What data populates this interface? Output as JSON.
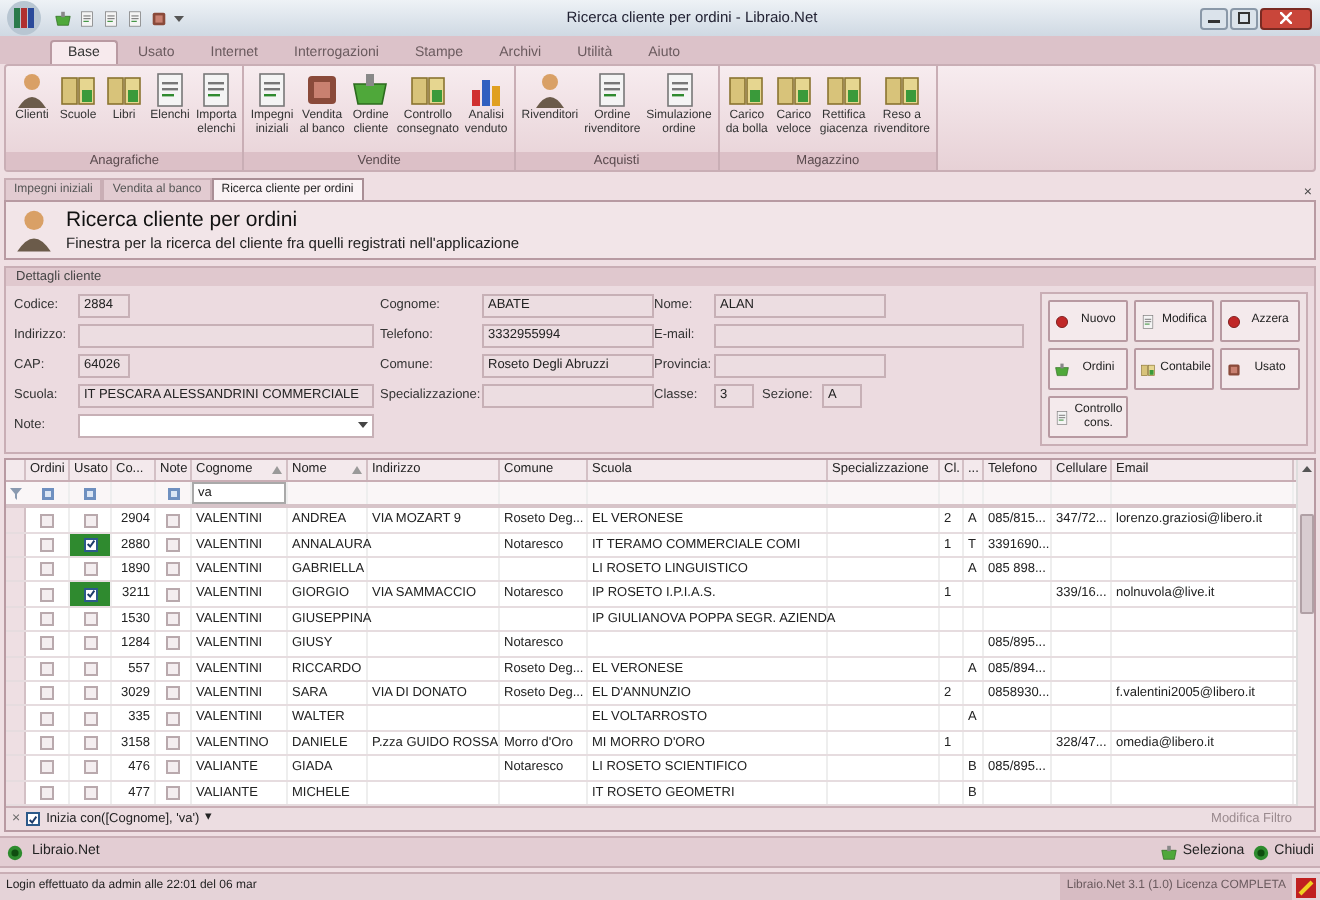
{
  "window": {
    "title": "Ricerca cliente per ordini - Libraio.Net"
  },
  "ribbon": {
    "tabs": [
      {
        "label": "Base",
        "selected": true
      },
      {
        "label": "Usato",
        "selected": false
      },
      {
        "label": "Internet",
        "selected": false
      },
      {
        "label": "Interrogazioni",
        "selected": false
      },
      {
        "label": "Stampe",
        "selected": false
      },
      {
        "label": "Archivi",
        "selected": false
      },
      {
        "label": "Utilità",
        "selected": false
      },
      {
        "label": "Aiuto",
        "selected": false
      }
    ],
    "groups": [
      {
        "title": "Anagrafiche",
        "buttons": [
          "Clienti",
          "Scuole",
          "Libri",
          "Elenchi",
          "Importa\nelenchi"
        ]
      },
      {
        "title": "Vendite",
        "buttons": [
          "Impegni\niniziali",
          "Vendita\nal banco",
          "Ordine\ncliente",
          "Controllo\nconsegnato",
          "Analisi\nvenduto"
        ]
      },
      {
        "title": "Acquisti",
        "buttons": [
          "Rivenditori",
          "Ordine\nrivenditore",
          "Simulazione\nordine"
        ]
      },
      {
        "title": "Magazzino",
        "buttons": [
          "Carico\nda bolla",
          "Carico\nveloce",
          "Rettifica\ngiacenza",
          "Reso a\nrivenditore"
        ]
      }
    ]
  },
  "doc_tabs": [
    {
      "label": "Impegni iniziali",
      "selected": false
    },
    {
      "label": "Vendita al banco",
      "selected": false
    },
    {
      "label": "Ricerca cliente per ordini",
      "selected": true
    }
  ],
  "doc_close": "×",
  "header": {
    "title": "Ricerca cliente per ordini",
    "subtitle": "Finestra per la ricerca del cliente fra quelli registrati nell'applicazione"
  },
  "details": {
    "title": "Dettagli cliente",
    "rows": [
      [
        [
          {
            "label": "Codice:",
            "value": "2884",
            "kind": "short"
          }
        ],
        [
          {
            "label": "Cognome:",
            "value": "ABATE",
            "kind": "medium"
          }
        ],
        [
          {
            "label": "Nome:",
            "value": "ALAN",
            "kind": "medium"
          }
        ]
      ],
      [
        [
          {
            "label": "Indirizzo:",
            "kind": "long"
          }
        ],
        [
          {
            "label": "Telefono:",
            "value": "3332955994",
            "kind": "medium"
          }
        ],
        [
          {
            "label": "E-mail:",
            "kind": "wide"
          }
        ]
      ],
      [
        [
          {
            "label": "CAP:",
            "value": "64026",
            "kind": "short"
          }
        ],
        [
          {
            "label": "Comune:",
            "value": "Roseto Degli Abruzzi",
            "kind": "medium"
          }
        ],
        [
          {
            "label": "Provincia:",
            "kind": "medium"
          }
        ]
      ],
      [
        [
          {
            "label": "Scuola:",
            "value": "IT PESCARA ALESSANDRINI COMMERCIALE",
            "kind": "long"
          }
        ],
        [
          {
            "label": "Specializzazione:",
            "kind": "medium"
          }
        ],
        [
          {
            "label": "Classe:",
            "value": "3",
            "kind": "tiny"
          },
          {
            "label": "Sezione:",
            "value": "A",
            "kind": "tiny"
          }
        ]
      ],
      [
        [
          {
            "label": "Note:",
            "kind": "dropdown"
          }
        ]
      ]
    ],
    "buttons": [
      "Nuovo",
      "Modifica",
      "Azzera",
      "Ordini",
      "Contabile",
      "Usato",
      "Controllo\ncons."
    ]
  },
  "table": {
    "columns": [
      "Ordini",
      "Usato",
      "Co...",
      "Note",
      "Cognome",
      "Nome",
      "Indirizzo",
      "Comune",
      "Scuola",
      "Specializzazione",
      "Cl.",
      "...",
      "Telefono",
      "Cellulare",
      "Email"
    ],
    "filter": {
      "cognome": "va"
    },
    "rows": [
      {
        "ordini": false,
        "usato": false,
        "note": false,
        "cells": [
          "",
          "",
          "2904",
          "",
          "VALENTINI",
          "ANDREA",
          "VIA MOZART 9",
          "Roseto Deg...",
          "EL VERONESE",
          null,
          "2",
          "A",
          "085/815...",
          "347/72...",
          "lorenzo.graziosi@libero.it"
        ]
      },
      {
        "ordini": false,
        "usato": true,
        "note": false,
        "cells": [
          "",
          "",
          "2880",
          "",
          "VALENTINI",
          "ANNALAURA",
          null,
          "Notaresco",
          "IT TERAMO COMMERCIALE COMI",
          null,
          "1",
          "T",
          "3391690...",
          null,
          null
        ]
      },
      {
        "ordini": false,
        "usato": false,
        "note": false,
        "cells": [
          "",
          "",
          "1890",
          "",
          "VALENTINI",
          "GABRIELLA",
          null,
          null,
          "LI ROSETO LINGUISTICO",
          null,
          null,
          "A",
          "085 898...",
          null,
          null
        ]
      },
      {
        "ordini": false,
        "usato": true,
        "note": false,
        "cells": [
          "",
          "",
          "3211",
          "",
          "VALENTINI",
          "GIORGIO",
          "VIA SAMMACCIO",
          "Notaresco",
          "IP ROSETO I.P.I.A.S.",
          null,
          "1",
          null,
          null,
          "339/16...",
          "nolnuvola@live.it"
        ]
      },
      {
        "ordini": false,
        "usato": false,
        "note": false,
        "cells": [
          "",
          "",
          "1530",
          "",
          "VALENTINI",
          "GIUSEPPINA",
          null,
          null,
          "IP GIULIANOVA POPPA SEGR. AZIENDA",
          null,
          null,
          null,
          null,
          null,
          null
        ]
      },
      {
        "ordini": false,
        "usato": false,
        "note": false,
        "cells": [
          "",
          "",
          "1284",
          "",
          "VALENTINI",
          "GIUSY",
          null,
          "Notaresco",
          null,
          null,
          null,
          null,
          "085/895...",
          null,
          null
        ]
      },
      {
        "ordini": false,
        "usato": false,
        "note": false,
        "cells": [
          "",
          "",
          "557",
          "",
          "VALENTINI",
          "RICCARDO",
          null,
          "Roseto Deg...",
          "EL VERONESE",
          null,
          null,
          "A",
          "085/894...",
          null,
          null
        ]
      },
      {
        "ordini": false,
        "usato": false,
        "note": false,
        "cells": [
          "",
          "",
          "3029",
          "",
          "VALENTINI",
          "SARA",
          "VIA DI DONATO",
          "Roseto Deg...",
          "EL D'ANNUNZIO",
          null,
          "2",
          null,
          "0858930...",
          null,
          "f.valentini2005@libero.it"
        ]
      },
      {
        "ordini": false,
        "usato": false,
        "note": false,
        "cells": [
          "",
          "",
          "335",
          "",
          "VALENTINI",
          "WALTER",
          null,
          null,
          "EL VOLTARROSTO",
          null,
          null,
          "A",
          null,
          null,
          null
        ]
      },
      {
        "ordini": false,
        "usato": false,
        "note": false,
        "cells": [
          "",
          "",
          "3158",
          "",
          "VALENTINO",
          "DANIELE",
          "P.zza GUIDO ROSSA",
          "Morro d'Oro",
          "MI MORRO D'ORO",
          null,
          "1",
          null,
          null,
          "328/47...",
          "omedia@libero.it"
        ]
      },
      {
        "ordini": false,
        "usato": false,
        "note": false,
        "cells": [
          "",
          "",
          "476",
          "",
          "VALIANTE",
          "GIADA",
          null,
          "Notaresco",
          "LI ROSETO SCIENTIFICO",
          null,
          null,
          "B",
          "085/895...",
          null,
          null
        ]
      },
      {
        "ordini": false,
        "usato": false,
        "note": false,
        "cells": [
          "",
          "",
          "477",
          "",
          "VALIANTE",
          "MICHELE",
          null,
          null,
          "IT ROSETO GEOMETRI",
          null,
          null,
          "B",
          null,
          null,
          null
        ]
      }
    ]
  },
  "filter_bar": {
    "close": "×",
    "enabled": true,
    "expression": "Inizia con([Cognome], 'va')",
    "dropdown": "▾",
    "edit": "Modifica Filtro"
  },
  "footer": {
    "app": "Libraio.Net",
    "buttons": [
      "Seleziona",
      "Chiudi"
    ]
  },
  "status_bar": {
    "message": "Login effettuato da admin alle 22:01 del 06 mar",
    "version": "Libraio.Net 3.1 (1.0) Licenza COMPLETA"
  }
}
